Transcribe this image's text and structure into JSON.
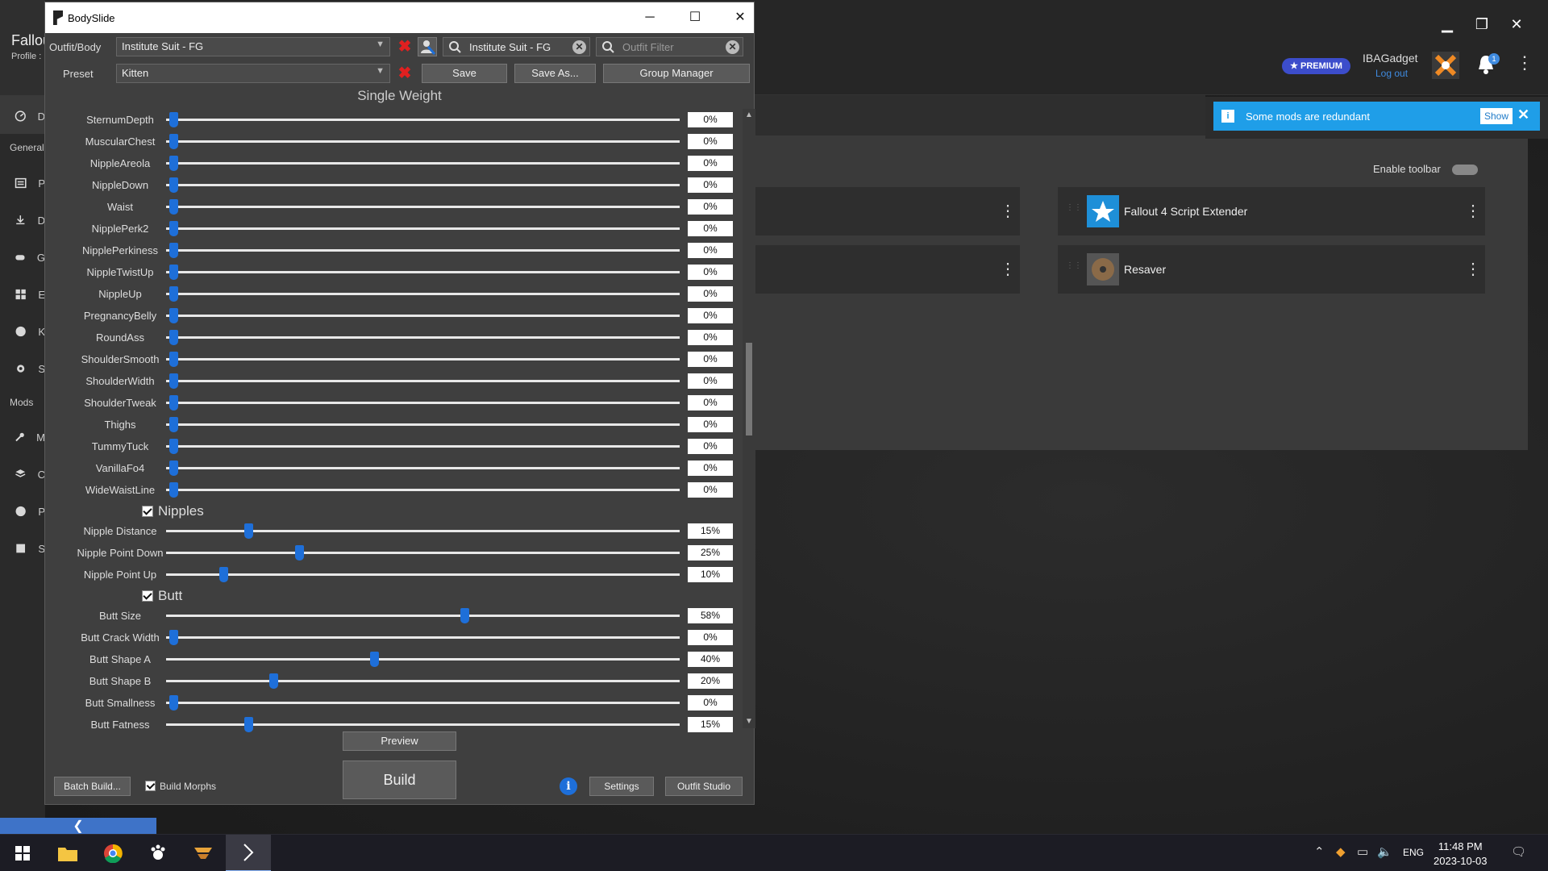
{
  "vortex": {
    "game_title": "Fallou",
    "profile_label": "Profile :",
    "nav_truncated": [
      "D",
      "P",
      "D",
      "G",
      "E",
      "K",
      "S",
      "M",
      "C",
      "P",
      "S"
    ],
    "section_general": "General",
    "section_mods": "Mods",
    "premium_badge": "★ PREMIUM",
    "username": "IBAGadget",
    "logout": "Log out",
    "notification_count": "1",
    "notification_text": "Some mods are redundant",
    "notification_show": "Show",
    "enable_toolbar": "Enable toolbar",
    "tools": [
      {
        "name": "Fallout 4 Script Extender",
        "icon": "star-icon"
      },
      {
        "name": "Resaver",
        "icon": "disc-icon"
      }
    ],
    "collapse_icon": "chevron-left-icon"
  },
  "bodyslide": {
    "title": "BodySlide",
    "outfit_label": "Outfit/Body",
    "outfit_value": "Institute Suit - FG",
    "outfit_search": "Institute Suit - FG",
    "outfit_filter_placeholder": "Outfit Filter",
    "preset_label": "Preset",
    "preset_value": "Kitten",
    "save": "Save",
    "save_as": "Save As...",
    "group_manager": "Group Manager",
    "heading": "Single Weight",
    "sliders_top": [
      {
        "name": "SternumDepth",
        "value": 0,
        "text": "0%"
      },
      {
        "name": "MuscularChest",
        "value": 0,
        "text": "0%"
      },
      {
        "name": "NippleAreola",
        "value": 0,
        "text": "0%"
      },
      {
        "name": "NippleDown",
        "value": 0,
        "text": "0%"
      },
      {
        "name": "Waist",
        "value": 0,
        "text": "0%"
      },
      {
        "name": "NipplePerk2",
        "value": 0,
        "text": "0%"
      },
      {
        "name": "NipplePerkiness",
        "value": 0,
        "text": "0%"
      },
      {
        "name": "NippleTwistUp",
        "value": 0,
        "text": "0%"
      },
      {
        "name": "NippleUp",
        "value": 0,
        "text": "0%"
      },
      {
        "name": "PregnancyBelly",
        "value": 0,
        "text": "0%"
      },
      {
        "name": "RoundAss",
        "value": 0,
        "text": "0%"
      },
      {
        "name": "ShoulderSmooth",
        "value": 0,
        "text": "0%"
      },
      {
        "name": "ShoulderWidth",
        "value": 0,
        "text": "0%"
      },
      {
        "name": "ShoulderTweak",
        "value": 0,
        "text": "0%"
      },
      {
        "name": "Thighs",
        "value": 0,
        "text": "0%"
      },
      {
        "name": "TummyTuck",
        "value": 0,
        "text": "0%"
      },
      {
        "name": "VanillaFo4",
        "value": 0,
        "text": "0%"
      },
      {
        "name": "WideWaistLine",
        "value": 0,
        "text": "0%"
      }
    ],
    "group_nipples": "Nipples",
    "sliders_nipples": [
      {
        "name": "Nipple Distance",
        "value": 15,
        "text": "15%"
      },
      {
        "name": "Nipple Point Down",
        "value": 25,
        "text": "25%"
      },
      {
        "name": "Nipple Point Up",
        "value": 10,
        "text": "10%"
      }
    ],
    "group_butt": "Butt",
    "sliders_butt": [
      {
        "name": "Butt Size",
        "value": 58,
        "text": "58%"
      },
      {
        "name": "Butt Crack Width",
        "value": 0,
        "text": "0%"
      },
      {
        "name": "Butt Shape A",
        "value": 40,
        "text": "40%"
      },
      {
        "name": "Butt Shape B",
        "value": 20,
        "text": "20%"
      },
      {
        "name": "Butt Smallness",
        "value": 0,
        "text": "0%"
      },
      {
        "name": "Butt Fatness",
        "value": 15,
        "text": "15%"
      }
    ],
    "preview": "Preview",
    "build": "Build",
    "batch_build": "Batch Build...",
    "build_morphs": "Build Morphs",
    "info": "i",
    "settings": "Settings",
    "outfit_studio": "Outfit Studio"
  },
  "taskbar": {
    "language": "ENG",
    "time": "11:48 PM",
    "date": "2023-10-03"
  }
}
